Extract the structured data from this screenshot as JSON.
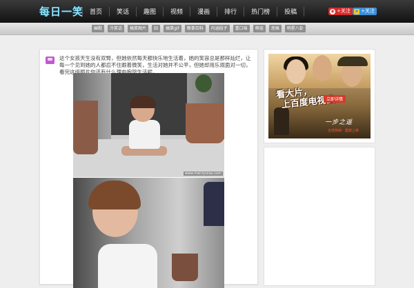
{
  "site": {
    "logo": "每日一笑"
  },
  "nav": {
    "items": [
      "首页",
      "笑话",
      "趣图",
      "视频",
      "漫画",
      "排行",
      "热门榜",
      "投稿"
    ]
  },
  "follow": {
    "weibo_label": "+关注",
    "qq_label": "+关注"
  },
  "tags": [
    "幽默",
    "冷笑话",
    "搞笑图片",
    "囧",
    "搞笑gif",
    "糗事百科",
    "内涵段子",
    "重口味",
    "萌宠",
    "恶搞",
    "明星八卦"
  ],
  "post": {
    "text": "这个女孩天生没有双臂，但她依然每天都快乐地生活着，她的笑容总是那样灿烂，让每一个见到她的人都忍不住跟着微笑，生活对她并不公平，但她却用乐观面对一切，看完这组照片你还有什么理由抱怨生活呢。",
    "photo_watermark": "www.meiriyixiao.com"
  },
  "ad": {
    "title_line1": "看大片，",
    "title_line2": "上百度电视云",
    "hd": "HD",
    "button": "立即详情",
    "logo": "一步之遥",
    "subtitle": "全球热映 · 震撼上映"
  }
}
